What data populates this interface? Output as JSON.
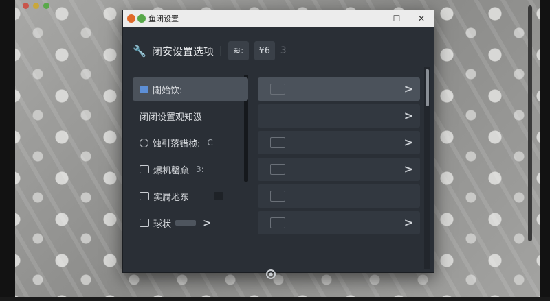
{
  "window": {
    "title": "鱼闭设置",
    "controls": {
      "minimize": "—",
      "maximize": "☐",
      "close": "✕"
    }
  },
  "toolbar": {
    "title": "闭安设置选项",
    "sep_char": "|",
    "btn1": "≋:",
    "btn2": "¥6",
    "faint": "3"
  },
  "rows": [
    {
      "label": "闥始饮:",
      "suffix": "",
      "chevron": ">",
      "active": true
    },
    {
      "label": "闭闭设置观知汲",
      "suffix": "",
      "chevron": ">"
    },
    {
      "label": "蚀引落错桢:",
      "suffix": "C",
      "chevron": ">"
    },
    {
      "label": "爆机罄窳",
      "suffix": "3:",
      "chevron": ">"
    },
    {
      "label": "实屙地东",
      "suffix": "",
      "chevron": ""
    },
    {
      "label": "球状",
      "suffix": "",
      "chevron": ">"
    }
  ],
  "colors": {
    "window_bg": "#2a2f36",
    "active_row": "#4b525b",
    "accent_blue": "#5d8fd6"
  }
}
